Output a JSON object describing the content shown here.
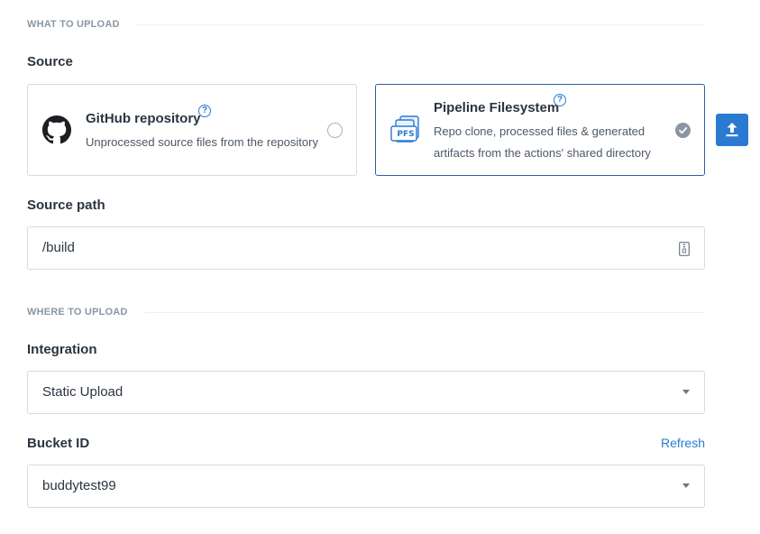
{
  "what_section": {
    "title": "WHAT TO UPLOAD"
  },
  "source": {
    "label": "Source",
    "options": [
      {
        "title": "GitHub repository",
        "description": "Unprocessed source files from the repository",
        "selected": false,
        "icon": "github-icon"
      },
      {
        "title": "Pipeline Filesystem",
        "description_line1": "Repo clone, processed files & generated",
        "description_line2": "artifacts from the actions' shared directory",
        "selected": true,
        "icon": "pfs-icon",
        "icon_text": "PFS"
      }
    ],
    "help_glyph": "?"
  },
  "source_path": {
    "label": "Source path",
    "value": "/build"
  },
  "where_section": {
    "title": "WHERE TO UPLOAD"
  },
  "integration": {
    "label": "Integration",
    "value": "Static Upload"
  },
  "bucket": {
    "label": "Bucket ID",
    "value": "buddytest99",
    "refresh_label": "Refresh"
  },
  "colors": {
    "accent": "#2a7ad2",
    "selected_border": "#2f5fa3",
    "muted": "#8a96a3"
  }
}
